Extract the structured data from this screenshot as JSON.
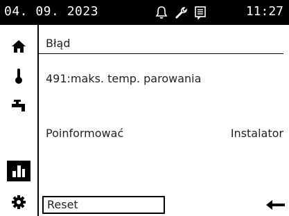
{
  "status_bar": {
    "date": "04. 09. 2023",
    "time": "11:27",
    "icons": [
      "bell-icon",
      "wrench-icon",
      "document-icon"
    ]
  },
  "nav": {
    "items": [
      {
        "icon": "home-icon",
        "active": false
      },
      {
        "icon": "thermometer-icon",
        "active": false
      },
      {
        "icon": "faucet-icon",
        "active": false
      },
      {
        "icon": "bar-chart-icon",
        "active": true
      },
      {
        "icon": "gear-icon",
        "active": false
      }
    ]
  },
  "content": {
    "title": "Błąd",
    "error_message": "491:maks. temp. parowania",
    "notify_label": "Poinformować",
    "notify_value": "Instalator",
    "reset_label": "Reset"
  },
  "colors": {
    "bar": "#000000",
    "background": "#ffffff",
    "text": "#222222"
  }
}
